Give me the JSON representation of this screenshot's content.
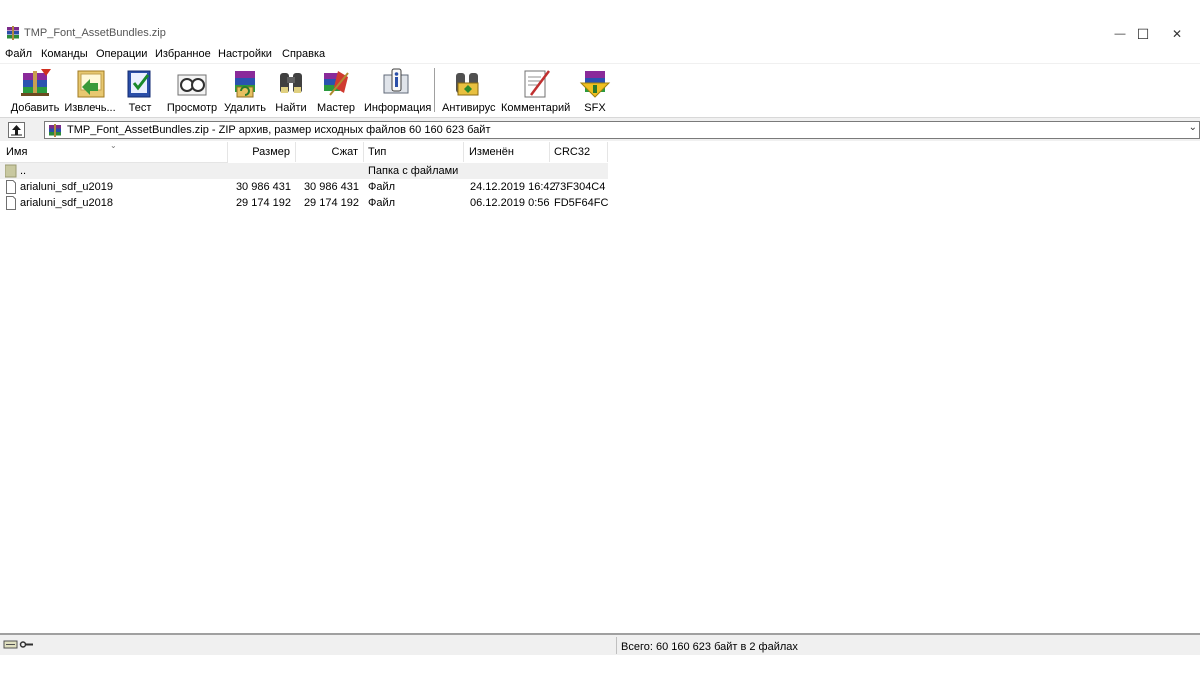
{
  "window": {
    "title": "TMP_Font_AssetBundles.zip",
    "minimize_glyph": "—",
    "maximize_glyph": "☐",
    "close_glyph": "✕"
  },
  "menu": {
    "items": [
      "Файл",
      "Команды",
      "Операции",
      "Избранное",
      "Настройки",
      "Справка"
    ]
  },
  "toolbar": {
    "buttons": [
      {
        "label": "Добавить",
        "icon": "add-archive-icon"
      },
      {
        "label": "Извлечь...",
        "icon": "extract-icon"
      },
      {
        "label": "Тест",
        "icon": "test-icon"
      },
      {
        "label": "Просмотр",
        "icon": "view-icon"
      },
      {
        "label": "Удалить",
        "icon": "delete-icon"
      },
      {
        "label": "Найти",
        "icon": "find-icon"
      },
      {
        "label": "Мастер",
        "icon": "wizard-icon"
      },
      {
        "label": "Информация",
        "icon": "info-icon"
      },
      {
        "label": "Антивирус",
        "icon": "antivirus-icon"
      },
      {
        "label": "Комментарий",
        "icon": "comment-icon"
      },
      {
        "label": "SFX",
        "icon": "sfx-icon"
      }
    ]
  },
  "address": {
    "text": "TMP_Font_AssetBundles.zip - ZIP архив, размер исходных файлов 60 160 623 байт"
  },
  "columns": {
    "name": "Имя",
    "size": "Размер",
    "packed": "Сжат",
    "type": "Тип",
    "modified": "Изменён",
    "crc": "CRC32"
  },
  "rows": [
    {
      "name": "..",
      "size": "",
      "packed": "",
      "type": "Папка с файлами",
      "modified": "",
      "crc": ""
    },
    {
      "name": "arialuni_sdf_u2019",
      "size": "30 986 431",
      "packed": "30 986 431",
      "type": "Файл",
      "modified": "24.12.2019 16:42",
      "crc": "73F304C4"
    },
    {
      "name": "arialuni_sdf_u2018",
      "size": "29 174 192",
      "packed": "29 174 192",
      "type": "Файл",
      "modified": "06.12.2019 0:56",
      "crc": "FD5F64FC"
    }
  ],
  "status": {
    "text": "Всего: 60 160 623 байт в 2 файлах"
  }
}
